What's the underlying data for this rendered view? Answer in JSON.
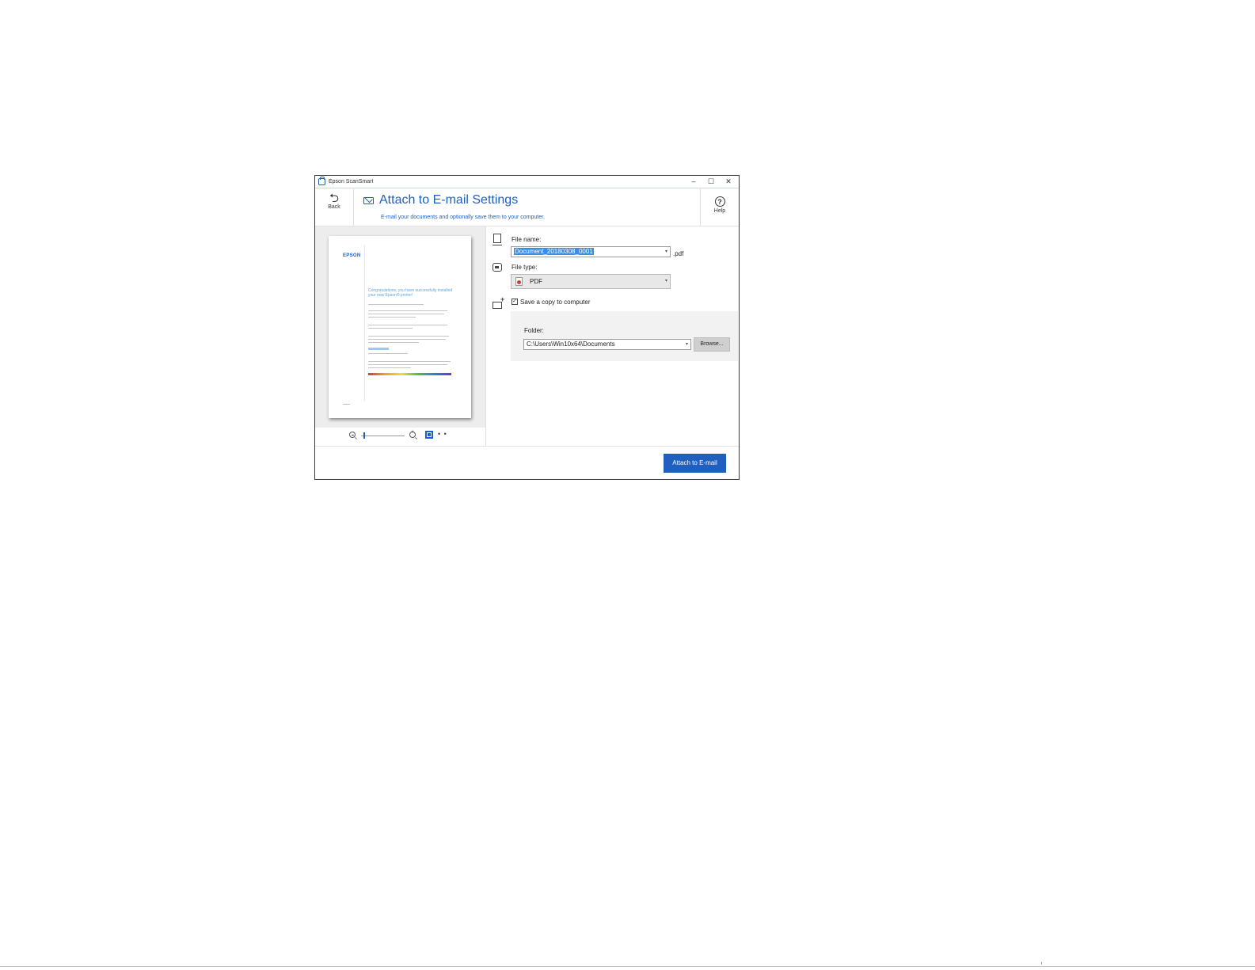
{
  "window": {
    "title": "Epson ScanSmart",
    "controls": {
      "minimize": "–",
      "maximize": "☐",
      "close": "✕"
    }
  },
  "header": {
    "back_icon": "back-arrow-icon",
    "back_glyph": "⮌",
    "back_label": "Back",
    "title_icon": "envelope-icon",
    "title": "Attach to E-mail Settings",
    "subtitle": "E-mail your documents and optionally save them to your computer.",
    "help_icon": "help-icon",
    "help_glyph": "?",
    "help_label": "Help"
  },
  "preview": {
    "doc_logo": "EPSON",
    "doc_heading": "Congratulations, you have successfully installed your new Epson® printer!",
    "zoom_level": 0.05,
    "icons": [
      "zoom-out-icon",
      "zoom-in-icon",
      "fit-page-icon",
      "page-nav-icon"
    ],
    "nav_glyph": "• •"
  },
  "settings": {
    "file_name_label": "File name:",
    "file_name_value": "Document_20180308_0001",
    "file_ext": ".pdf",
    "file_type_label": "File type:",
    "file_type_value": "PDF",
    "save_copy_checked": true,
    "save_copy_label": "Save a copy to computer",
    "folder_label": "Folder:",
    "folder_value": "C:\\Users\\Win10x64\\Documents",
    "browse_label": "Browse...",
    "dropdown_glyph": "▾",
    "check_glyph": "✓"
  },
  "footer": {
    "attach_label": "Attach to E-mail"
  },
  "colors": {
    "accent": "#1f5fbf",
    "selection": "#3b8ee6",
    "preview_bg": "#ededed"
  }
}
